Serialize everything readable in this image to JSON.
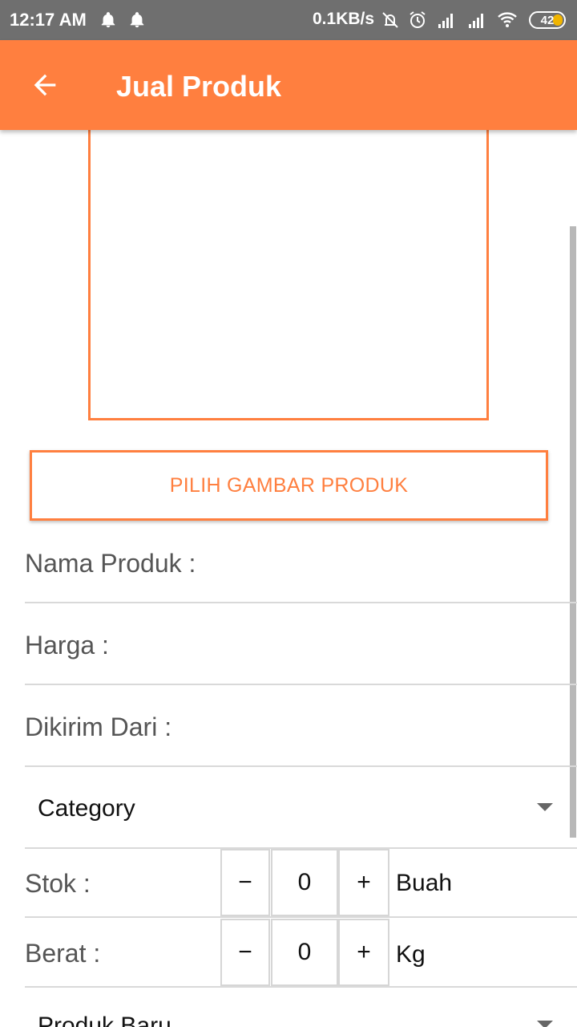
{
  "status_bar": {
    "time": "12:17 AM",
    "network_speed": "0.1KB/s",
    "battery": "42",
    "icons": [
      "bell-icon",
      "bell-icon",
      "alarm-off-icon",
      "alarm-clock-icon",
      "signal-icon",
      "signal-icon",
      "wifi-icon",
      "battery-icon"
    ]
  },
  "app_bar": {
    "title": "Jual Produk",
    "back_icon": "arrow-left-icon"
  },
  "form": {
    "pick_image_label": "PILIH GAMBAR PRODUK",
    "name_label": "Nama Produk :",
    "price_label": "Harga :",
    "origin_label": "Dikirim Dari :",
    "category_selected": "Category",
    "stock": {
      "label": "Stok :",
      "value": "0",
      "minus": "−",
      "plus": "+",
      "unit": "Buah"
    },
    "weight": {
      "label": "Berat  :",
      "value": "0",
      "minus": "−",
      "plus": "+",
      "unit": "Kg"
    },
    "condition_selected": "Produk Baru"
  },
  "colors": {
    "accent": "#ff7f3f",
    "status_bar": "#6f6f6f"
  }
}
